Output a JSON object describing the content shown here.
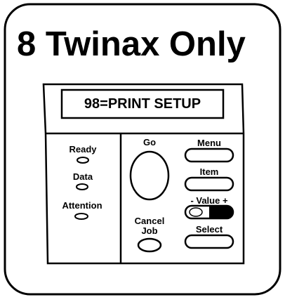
{
  "title": "8  Twinax Only",
  "display": {
    "text": "98=PRINT SETUP"
  },
  "indicators": [
    {
      "label": "Ready"
    },
    {
      "label": "Data"
    },
    {
      "label": "Attention"
    }
  ],
  "buttons": {
    "go": "Go",
    "cancel_line1": "Cancel",
    "cancel_line2": "Job",
    "menu": "Menu",
    "item": "Item",
    "value": "- Value +",
    "select": "Select"
  },
  "colors": {
    "ink": "#000000",
    "paper": "#ffffff"
  }
}
